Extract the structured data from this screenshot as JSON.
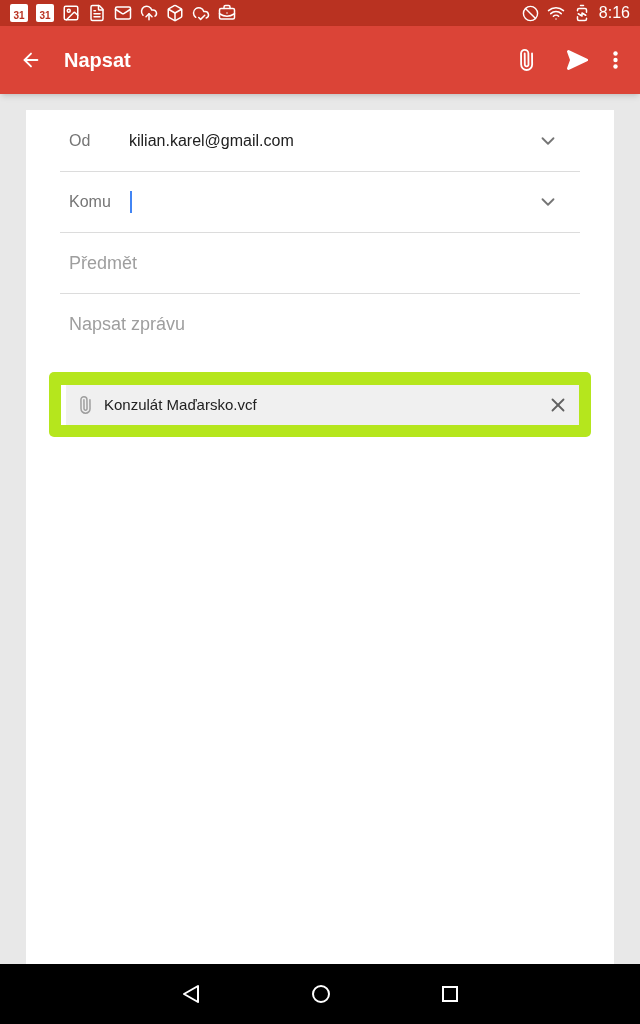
{
  "status_bar": {
    "notifications": [
      {
        "kind": "calendar",
        "label": "31"
      },
      {
        "kind": "calendar",
        "label": "31"
      },
      {
        "kind": "image"
      },
      {
        "kind": "file"
      },
      {
        "kind": "mail"
      },
      {
        "kind": "upload"
      },
      {
        "kind": "dropbox"
      },
      {
        "kind": "cloud-check"
      },
      {
        "kind": "briefcase"
      }
    ],
    "time": "8:16"
  },
  "app_bar": {
    "title": "Napsat"
  },
  "fields": [
    {
      "kind": "account",
      "label": "Od",
      "value": "kilian.karel@gmail.com",
      "focused": false
    },
    {
      "kind": "recipient",
      "label": "Komu",
      "focused": true
    },
    {
      "kind": "text",
      "placeholder": "Předmět"
    },
    {
      "kind": "text",
      "placeholder": "Napsat zprávu"
    }
  ],
  "attachments": [
    {
      "name": "Konzulát Maďarsko.vcf",
      "highlighted": true
    }
  ]
}
